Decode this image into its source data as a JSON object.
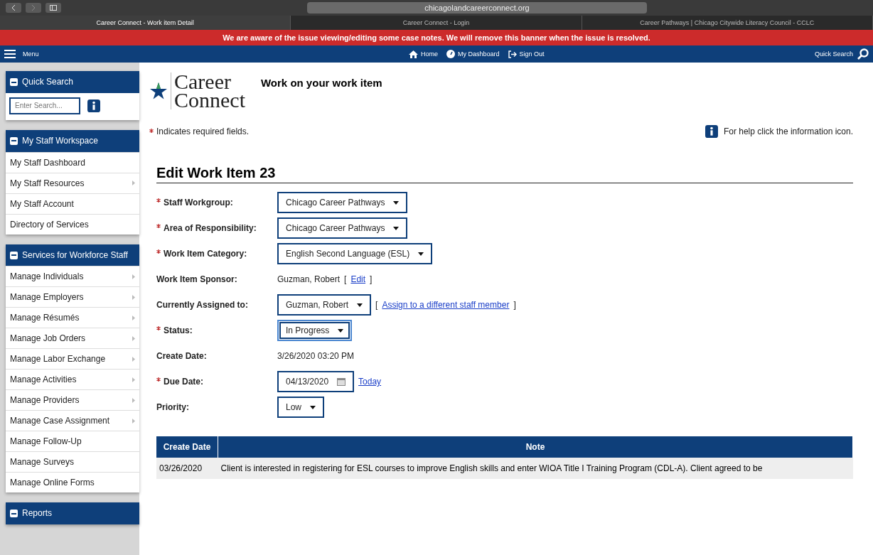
{
  "browser": {
    "url": "chicagolandcareerconnect.org",
    "tabs": [
      {
        "label": "Career Connect - Work item Detail",
        "selected": true
      },
      {
        "label": "Career Connect - Login",
        "selected": false
      },
      {
        "label": "Career Pathways | Chicago Citywide Literacy Council - CCLC",
        "selected": false
      }
    ]
  },
  "banner": "We are aware of the issue viewing/editing some case notes. We will remove this banner when the issue is resolved.",
  "nav": {
    "menu": "Menu",
    "links": [
      "Home",
      "My Dashboard",
      "Sign Out"
    ],
    "quick_search": "Quick Search"
  },
  "sidebar": [
    {
      "title": "Quick Search",
      "search": {
        "placeholder": "Enter Search..."
      }
    },
    {
      "title": "My Staff Workspace",
      "items": [
        {
          "label": "My Staff Dashboard",
          "submenu": false
        },
        {
          "label": "My Staff Resources",
          "submenu": true
        },
        {
          "label": "My Staff Account",
          "submenu": false
        },
        {
          "label": "Directory of Services",
          "submenu": false
        }
      ]
    },
    {
      "title": "Services for Workforce Staff",
      "items": [
        {
          "label": "Manage Individuals",
          "submenu": true
        },
        {
          "label": "Manage Employers",
          "submenu": true
        },
        {
          "label": "Manage Résumés",
          "submenu": true
        },
        {
          "label": "Manage Job Orders",
          "submenu": true
        },
        {
          "label": "Manage Labor Exchange",
          "submenu": true
        },
        {
          "label": "Manage Activities",
          "submenu": true
        },
        {
          "label": "Manage Providers",
          "submenu": true
        },
        {
          "label": "Manage Case Assignment",
          "submenu": true
        },
        {
          "label": "Manage Follow-Up",
          "submenu": false
        },
        {
          "label": "Manage Surveys",
          "submenu": false
        },
        {
          "label": "Manage Online Forms",
          "submenu": false
        }
      ]
    },
    {
      "title": "Reports"
    }
  ],
  "logo": {
    "line1": "Career",
    "line2": "Connect"
  },
  "page_title": "Work on your work item",
  "required_note": "Indicates required fields.",
  "help_note": "For help click the information icon.",
  "heading": "Edit Work Item 23",
  "fields": [
    {
      "label": "Staff Workgroup:",
      "required": true,
      "kind": "select",
      "value": "Chicago Career Pathways",
      "focused": false
    },
    {
      "label": "Area of Responsibility:",
      "required": true,
      "kind": "select",
      "value": "Chicago Career Pathways",
      "focused": false
    },
    {
      "label": "Work Item Category:",
      "required": true,
      "kind": "select",
      "value": "English Second Language (ESL)",
      "focused": false
    },
    {
      "label": "Work Item Sponsor:",
      "required": false,
      "kind": "text",
      "value": "Guzman, Robert",
      "link": "Edit",
      "bracket_open": "[",
      "bracket_close": "]"
    },
    {
      "label": "Currently Assigned to:",
      "required": false,
      "kind": "select",
      "value": "Guzman, Robert",
      "focused": false,
      "link": "Assign to a different staff member",
      "bracket_open": "[",
      "bracket_close": "]"
    },
    {
      "label": "Status:",
      "required": true,
      "kind": "select",
      "value": "In Progress",
      "focused": true
    },
    {
      "label": "Create Date:",
      "required": false,
      "kind": "text",
      "value": "3/26/2020 03:20 PM"
    },
    {
      "label": "Due Date:",
      "required": true,
      "kind": "date",
      "value": "04/13/2020",
      "shortcut": "Today"
    },
    {
      "label": "Priority:",
      "required": false,
      "kind": "select",
      "value": "Low",
      "focused": false
    }
  ],
  "notes_table": {
    "columns": [
      "Create Date",
      "Note"
    ],
    "rows": [
      [
        "03/26/2020",
        "Client is interested in registering for ESL courses to improve English skills and enter WIOA Title I Training Program (CDL-A). Client agreed to be"
      ]
    ]
  }
}
